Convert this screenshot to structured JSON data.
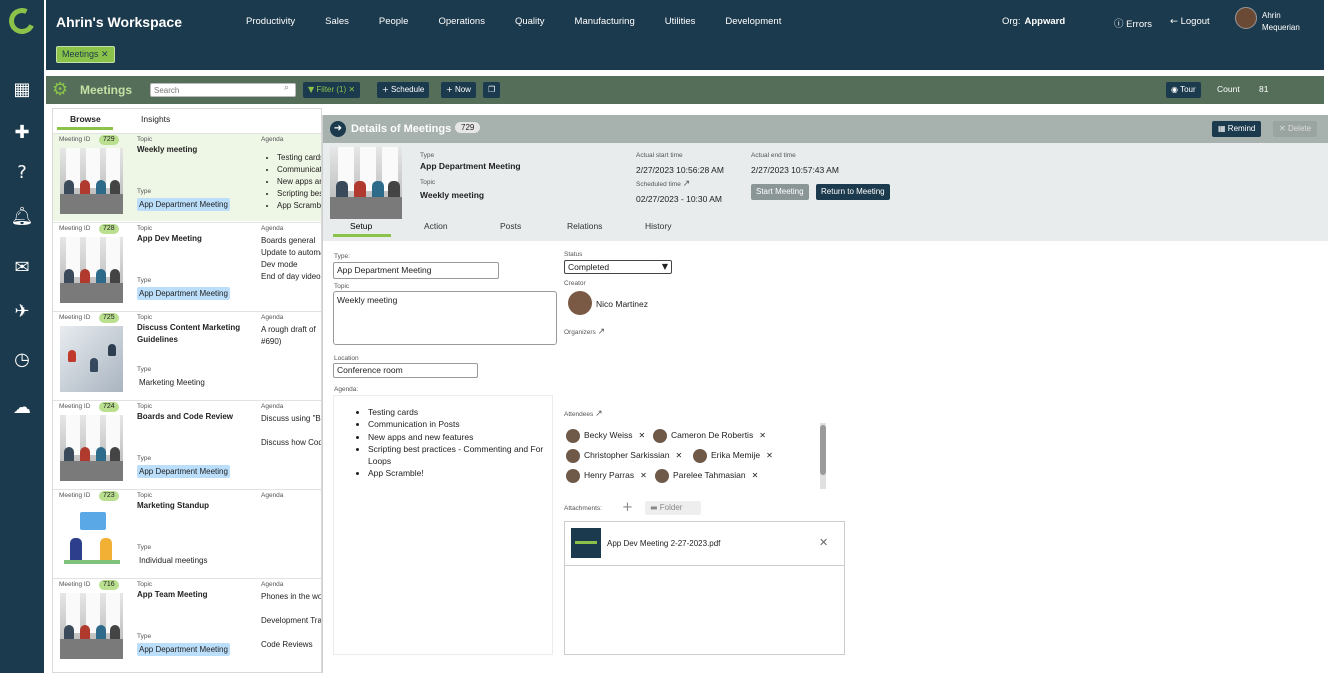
{
  "header": {
    "workspace_title": "Ahrin's Workspace",
    "nav": [
      "Productivity",
      "Sales",
      "People",
      "Operations",
      "Quality",
      "Manufacturing",
      "Utilities",
      "Development"
    ],
    "org_label": "Org:",
    "org_value": "Appward",
    "errors_label": "Errors",
    "logout_label": "Logout",
    "user_first": "Ahrin",
    "user_last": "Mequerian",
    "open_tab": "Meetings"
  },
  "toolbar": {
    "title": "Meetings",
    "search_placeholder": "Search",
    "filter_label": "Filter (1)",
    "schedule_label": "Schedule",
    "now_label": "Now",
    "tour_label": "Tour",
    "count_label": "Count",
    "count_value": "81"
  },
  "list": {
    "tabs": [
      "Browse",
      "Insights"
    ],
    "labels": {
      "meeting_id": "Meeting ID",
      "topic": "Topic",
      "agenda": "Agenda",
      "type": "Type"
    },
    "items": [
      {
        "id": "729",
        "topic": "Weekly meeting",
        "type": "App Department Meeting",
        "agenda": [
          "Testing cards",
          "Communication in Posts",
          "New apps and new features",
          "Scripting best practices",
          "App Scramble!"
        ]
      },
      {
        "id": "728",
        "topic": "App Dev Meeting",
        "type": "App Department Meeting",
        "agenda": [
          "Boards general",
          "Update to automation",
          "Dev mode",
          "End of day video"
        ]
      },
      {
        "id": "725",
        "topic": "Discuss Content Marketing Guidelines",
        "type": "Marketing Meeting",
        "agenda": [
          "A rough draft of",
          "#690)"
        ]
      },
      {
        "id": "724",
        "topic": "Boards and Code Review",
        "type": "App Department Meeting",
        "agenda": [
          "Discuss using \"Boards\"",
          "",
          "Discuss how Code"
        ]
      },
      {
        "id": "723",
        "topic": "Marketing Standup",
        "type": "Individual meetings",
        "agenda": []
      },
      {
        "id": "716",
        "topic": "App Team Meeting",
        "type": "App Department Meeting",
        "agenda": [
          "Phones in the workplace",
          "",
          "Development Training",
          "",
          "Code Reviews"
        ]
      }
    ]
  },
  "details": {
    "title": "Details of Meetings",
    "count": "729",
    "remind_label": "Remind",
    "delete_label": "Delete",
    "type_label": "Type",
    "type_value": "App Department Meeting",
    "topic_label": "Topic",
    "topic_value": "Weekly meeting",
    "actual_start_label": "Actual start time",
    "actual_start_value": "2/27/2023 10:56:28 AM",
    "scheduled_label": "Scheduled time",
    "scheduled_value": "02/27/2023 - 10:30 AM",
    "actual_end_label": "Actual end time",
    "actual_end_value": "2/27/2023 10:57:43 AM",
    "start_meeting_label": "Start Meeting",
    "return_meeting_label": "Return to Meeting",
    "tabs": [
      "Setup",
      "Action",
      "Posts",
      "Relations",
      "History"
    ],
    "form": {
      "type_label": "Type:",
      "type_value": "App Department Meeting",
      "topic_label": "Topic",
      "topic_value": "Weekly meeting",
      "location_label": "Location",
      "location_value": "Conference room",
      "agenda_label": "Agenda:",
      "agenda_items": [
        "Testing cards",
        "Communication in Posts",
        "New apps and new features",
        "Scripting best practices - Commenting and For Loops",
        "App Scramble!"
      ],
      "status_label": "Status",
      "status_value": "Completed",
      "creator_label": "Creator",
      "creator_name": "Nico Martinez",
      "organizers_label": "Organizers",
      "attendees_label": "Attendees",
      "attendees": [
        "Becky Weiss",
        "Cameron De Robertis",
        "Christopher Sarkissian",
        "Erika Memije",
        "Henry Parras",
        "Parelee Tahmasian"
      ],
      "attachments_label": "Attachments:",
      "folder_label": "Folder",
      "file_name": "App Dev Meeting 2-27-2023.pdf"
    }
  },
  "colors": {
    "navy": "#1c3a4d",
    "accent": "#8bc34a",
    "toolbar": "#546e5a",
    "chip_blue": "#bbdefb"
  }
}
